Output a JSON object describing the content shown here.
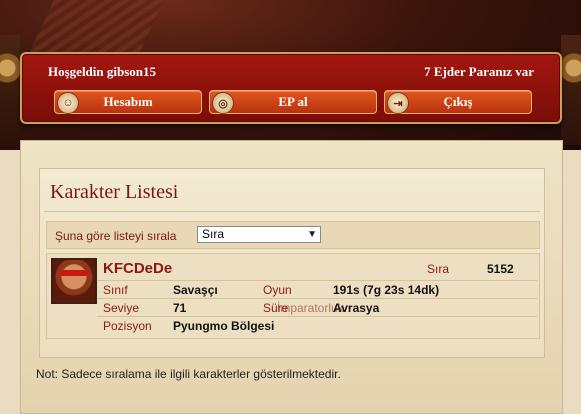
{
  "header": {
    "welcome": "Hoşgeldin gibson15",
    "dragon_money": "7 Ejder Paranız var",
    "buttons": {
      "account": "Hesabım",
      "ep": "EP al",
      "logout": "Çıkış"
    }
  },
  "list": {
    "title": "Karakter Listesi",
    "sort_label": "Şuna göre listeyi sırala",
    "sort_selected": "Sıra"
  },
  "character": {
    "name": "KFCDeDe",
    "rank_label": "Sıra",
    "rank_value": "5152",
    "class_label": "Sınıf",
    "class_value": "Savaşçı",
    "playtime_label": "Oyun",
    "playtime_value": "191s (7g 23s 14dk)",
    "level_label": "Seviye",
    "level_value": "71",
    "empire_label": "Süre",
    "empire_label_overlap": "İmparatorluk",
    "empire_value": "Avrasya",
    "position_label": "Pozisyon",
    "position_value": "Pyungmo Bölgesi"
  },
  "note": "Not: Sadece sıralama ile ilgili karakterler gösterilmektedir."
}
